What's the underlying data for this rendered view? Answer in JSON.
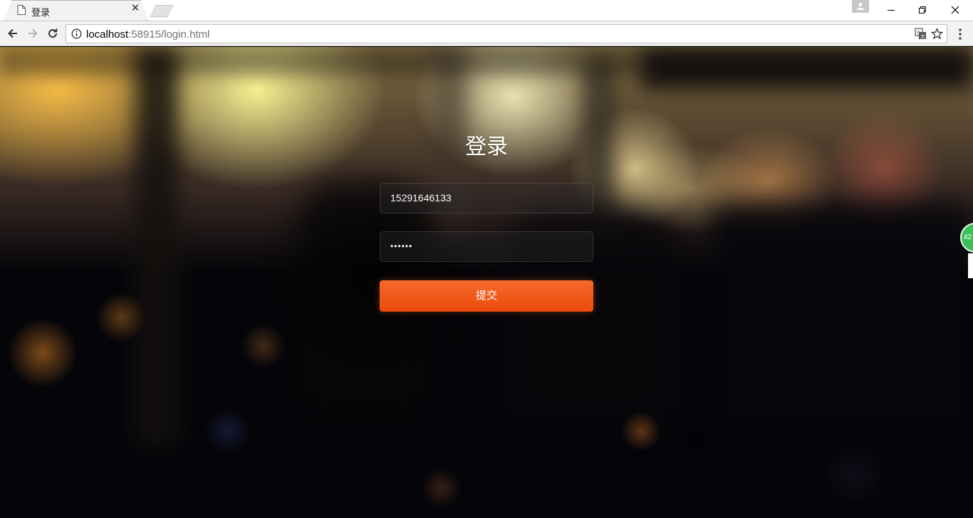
{
  "browser": {
    "tab_title": "登录",
    "tab_close": "✕",
    "url_host": "localhost",
    "url_rest": ":58915/login.html"
  },
  "login": {
    "title": "登录",
    "phone_value": "15291646133",
    "password_mask": "••••••",
    "submit_label": "提交"
  },
  "side_widget": {
    "label": "42"
  },
  "colors": {
    "submit_top": "#f56a2a",
    "submit_bottom": "#ea4a0d",
    "side_widget": "#3fbf5a"
  }
}
